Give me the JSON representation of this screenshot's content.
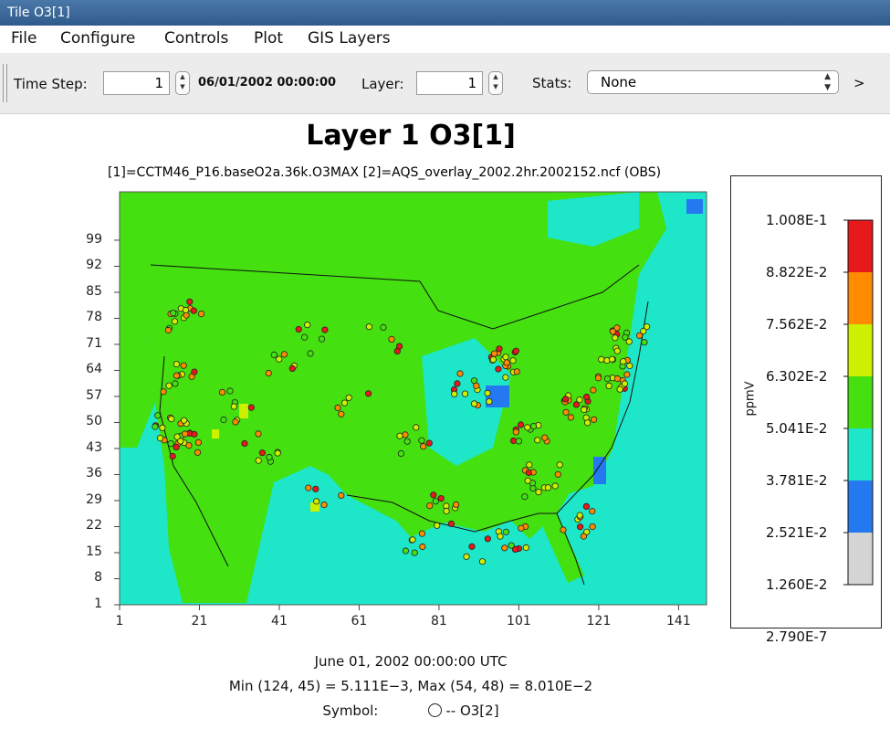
{
  "window": {
    "title": "Tile O3[1]"
  },
  "menu": [
    "File",
    "Configure",
    "Controls",
    "Plot",
    "GIS Layers"
  ],
  "toolbar": {
    "time_step_label": "Time Step:",
    "time_step_value": "1",
    "timestamp": "06/01/2002 00:00:00",
    "layer_label": "Layer:",
    "layer_value": "1",
    "stats_label": "Stats:",
    "stats_value": "None",
    "more": ">"
  },
  "plot": {
    "title": "Layer 1 O3[1]",
    "subtitle": "[1]=CCTM46_P16.baseO2a.36k.O3MAX  [2]=AQS_overlay_2002.2hr.2002152.ncf (OBS)",
    "footer_date": "June 01, 2002 00:00:00 UTC",
    "footer_minmax": "Min (124, 45) = 5.111E−3, Max (54, 48) = 8.010E−2",
    "symbol_label": "Symbol:",
    "symbol_series": "-- O3[2]"
  },
  "chart_data": {
    "type": "heatmap",
    "x_ticks": [
      "1",
      "21",
      "41",
      "61",
      "81",
      "101",
      "121",
      "141"
    ],
    "y_ticks": [
      "99",
      "92",
      "85",
      "78",
      "71",
      "64",
      "57",
      "50",
      "43",
      "36",
      "29",
      "22",
      "15",
      "8",
      "1"
    ],
    "xlim": [
      1,
      148
    ],
    "ylim": [
      1,
      112
    ],
    "legend": {
      "unit": "ppmV",
      "breaks": [
        "1.008E-1",
        "8.822E-2",
        "7.562E-2",
        "6.302E-2",
        "5.041E-2",
        "3.781E-2",
        "2.521E-2",
        "1.260E-2",
        "2.790E-7"
      ],
      "colors": [
        "#e8191b",
        "#ff8c00",
        "#ccf000",
        "#44e010",
        "#1ee6c8",
        "#2478f0",
        "#d4d4d4"
      ]
    },
    "grid": false,
    "overlay": "O3[2] observation symbols"
  }
}
